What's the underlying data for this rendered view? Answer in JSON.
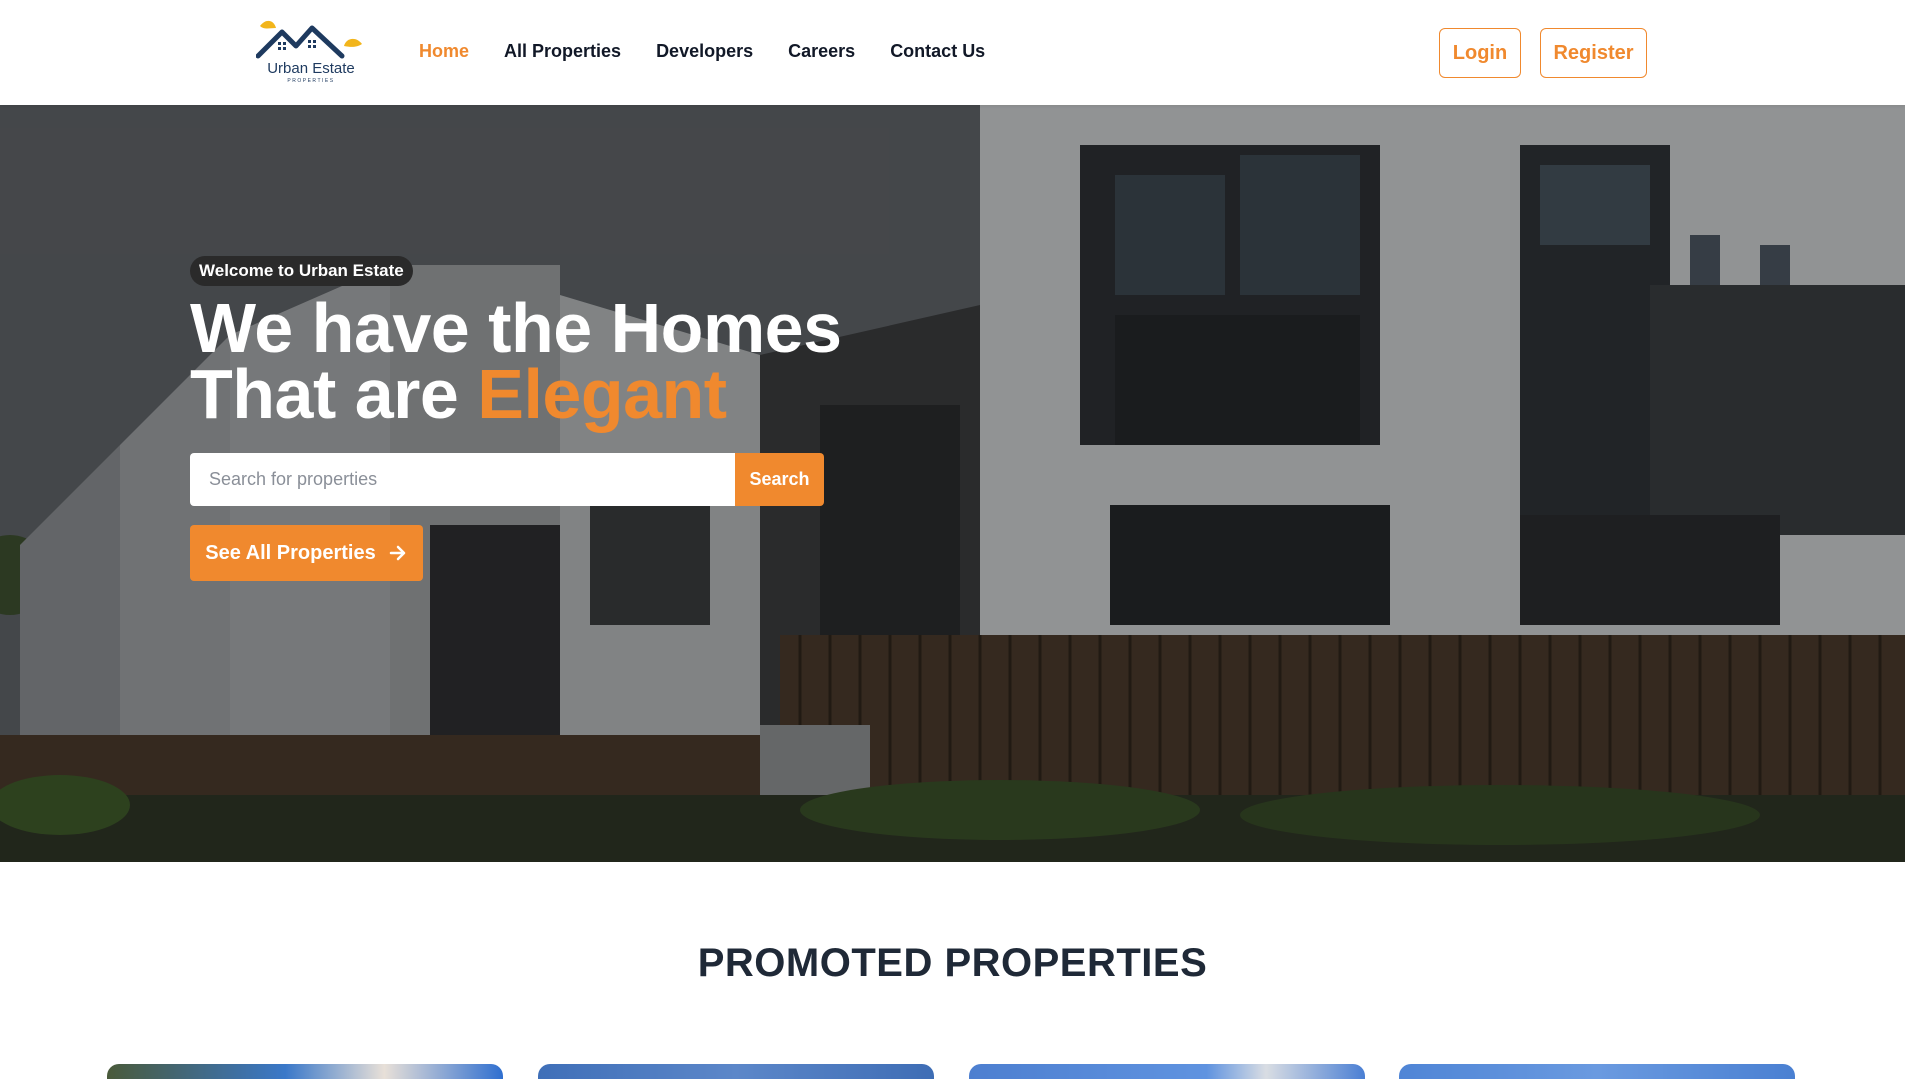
{
  "brand": {
    "name": "Urban Estate",
    "tagline": "PROPERTIES",
    "colors": {
      "accent": "#f0892e",
      "navy": "#1e3a5f",
      "leaf": "#f2b51b"
    }
  },
  "nav": {
    "items": [
      {
        "label": "Home",
        "active": true
      },
      {
        "label": "All Properties",
        "active": false
      },
      {
        "label": "Developers",
        "active": false
      },
      {
        "label": "Careers",
        "active": false
      },
      {
        "label": "Contact Us",
        "active": false
      }
    ],
    "login_label": "Login",
    "register_label": "Register"
  },
  "hero": {
    "badge": "Welcome to Urban Estate",
    "title_line1": "We have the Homes",
    "title_line2_prefix": "That are ",
    "title_line2_accent": "Elegant",
    "search": {
      "placeholder": "Search for properties",
      "button_label": "Search"
    },
    "cta_label": "See All Properties",
    "cta_icon": "arrow-right-icon"
  },
  "promoted": {
    "title": "PROMOTED PROPERTIES"
  }
}
